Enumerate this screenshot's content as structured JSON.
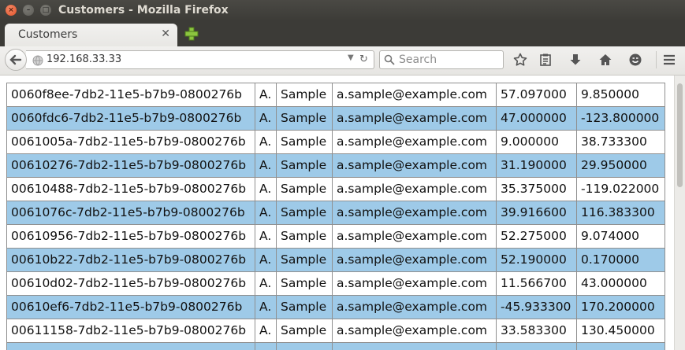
{
  "window": {
    "title": "Customers - Mozilla Firefox"
  },
  "tabs": [
    {
      "label": "Customers"
    }
  ],
  "navbar": {
    "url": "192.168.33.33",
    "search_placeholder": "Search"
  },
  "icons": {
    "close": "close-icon",
    "minimize": "minimize-icon",
    "maximize": "maximize-icon",
    "new_tab": "plus-icon",
    "back": "arrow-left-icon",
    "globe": "globe-icon",
    "dropdown": "chevron-down-icon",
    "reload": "reload-icon",
    "search": "search-icon",
    "bookmark": "star-icon",
    "reading_list": "clipboard-icon",
    "downloads": "download-arrow-icon",
    "home": "home-icon",
    "social": "smiley-icon",
    "menu": "hamburger-menu-icon"
  },
  "colors": {
    "alt_row": "#9ecae8",
    "titlebar": "#3c3b37",
    "close_button": "#e0522a"
  },
  "rows": [
    {
      "id": "0060f8ee-7db2-11e5-b7b9-0800276b",
      "initial": "A.",
      "last": "Sample",
      "email": "a.sample@example.com",
      "lat": "57.097000",
      "lng": "9.850000"
    },
    {
      "id": "0060fdc6-7db2-11e5-b7b9-0800276b",
      "initial": "A.",
      "last": "Sample",
      "email": "a.sample@example.com",
      "lat": "47.000000",
      "lng": "-123.800000"
    },
    {
      "id": "0061005a-7db2-11e5-b7b9-0800276b",
      "initial": "A.",
      "last": "Sample",
      "email": "a.sample@example.com",
      "lat": "9.000000",
      "lng": "38.733300"
    },
    {
      "id": "00610276-7db2-11e5-b7b9-0800276b",
      "initial": "A.",
      "last": "Sample",
      "email": "a.sample@example.com",
      "lat": "31.190000",
      "lng": "29.950000"
    },
    {
      "id": "00610488-7db2-11e5-b7b9-0800276b",
      "initial": "A.",
      "last": "Sample",
      "email": "a.sample@example.com",
      "lat": "35.375000",
      "lng": "-119.022000"
    },
    {
      "id": "0061076c-7db2-11e5-b7b9-0800276b",
      "initial": "A.",
      "last": "Sample",
      "email": "a.sample@example.com",
      "lat": "39.916600",
      "lng": "116.383300"
    },
    {
      "id": "00610956-7db2-11e5-b7b9-0800276b",
      "initial": "A.",
      "last": "Sample",
      "email": "a.sample@example.com",
      "lat": "52.275000",
      "lng": "9.074000"
    },
    {
      "id": "00610b22-7db2-11e5-b7b9-0800276b",
      "initial": "A.",
      "last": "Sample",
      "email": "a.sample@example.com",
      "lat": "52.190000",
      "lng": "0.170000"
    },
    {
      "id": "00610d02-7db2-11e5-b7b9-0800276b",
      "initial": "A.",
      "last": "Sample",
      "email": "a.sample@example.com",
      "lat": "11.566700",
      "lng": "43.000000"
    },
    {
      "id": "00610ef6-7db2-11e5-b7b9-0800276b",
      "initial": "A.",
      "last": "Sample",
      "email": "a.sample@example.com",
      "lat": "-45.933300",
      "lng": "170.200000"
    },
    {
      "id": "00611158-7db2-11e5-b7b9-0800276b",
      "initial": "A.",
      "last": "Sample",
      "email": "a.sample@example.com",
      "lat": "33.583300",
      "lng": "130.450000"
    },
    {
      "id": "",
      "initial": "",
      "last": "",
      "email": "",
      "lat": "",
      "lng": ""
    }
  ]
}
